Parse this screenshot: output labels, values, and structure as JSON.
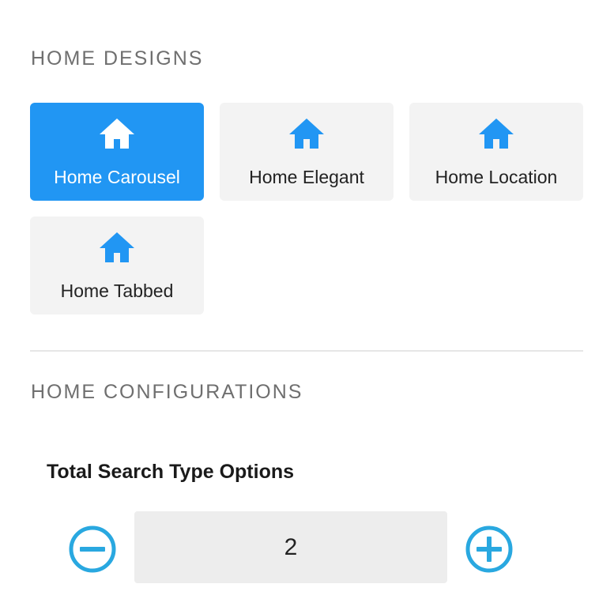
{
  "home_designs": {
    "title": "HOME DESIGNS",
    "tiles": [
      {
        "label": "Home Carousel",
        "icon": "home-icon",
        "selected": true
      },
      {
        "label": "Home Elegant",
        "icon": "home-icon",
        "selected": false
      },
      {
        "label": "Home Location",
        "icon": "home-icon",
        "selected": false
      },
      {
        "label": "Home Tabbed",
        "icon": "home-icon",
        "selected": false
      }
    ]
  },
  "home_configurations": {
    "title": "HOME CONFIGURATIONS",
    "total_search_type_options": {
      "label": "Total Search Type Options",
      "value": "2",
      "decrement_icon": "minus-circle-icon",
      "increment_icon": "plus-circle-icon"
    }
  },
  "colors": {
    "accent": "#2196f3",
    "stepper_icon": "#29a8e0",
    "tile_background": "#f3f3f3",
    "section_title": "#6f6f6f"
  }
}
